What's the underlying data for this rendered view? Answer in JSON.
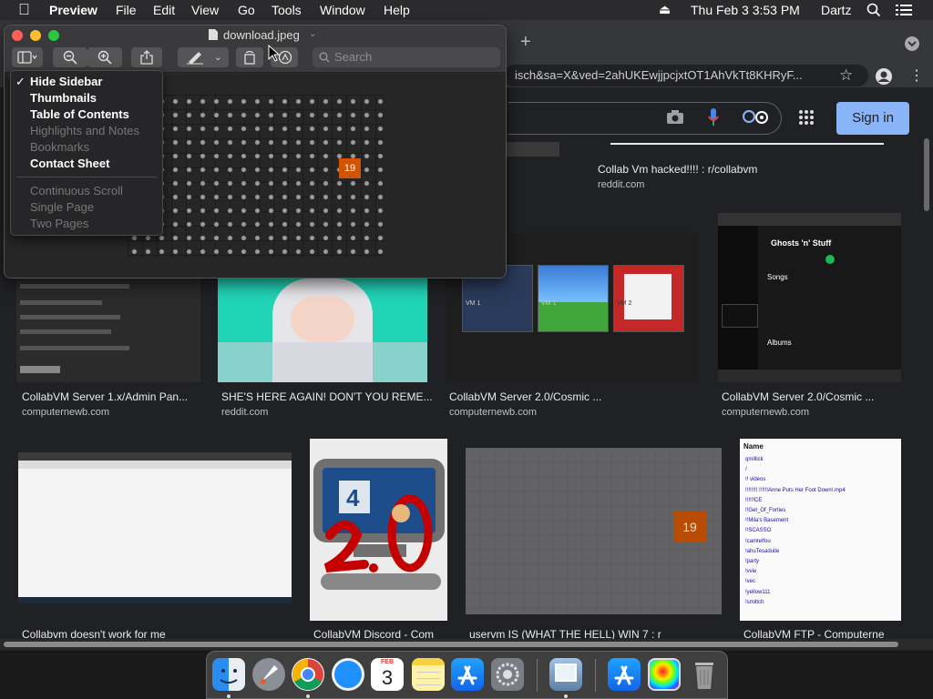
{
  "menubar": {
    "app": "Preview",
    "items": [
      "File",
      "Edit",
      "View",
      "Go",
      "Tools",
      "Window",
      "Help"
    ],
    "clock": "Thu Feb 3  3:53 PM",
    "user": "Dartz"
  },
  "browser": {
    "url": "isch&sa=X&ved=2ahUKEwjjpcjxtOT1AhVkTt8KHRyF...",
    "signin": "Sign in",
    "results": [
      {
        "caption": "Collab Vm hacked!!!! : r/collabvm",
        "source": "reddit.com"
      },
      {
        "caption": "CollabVM Server 1.x/Admin Pan...",
        "source": "computernewb.com"
      },
      {
        "caption": "SHE'S HERE AGAIN! DON'T YOU REME...",
        "source": "reddit.com"
      },
      {
        "caption": "CollabVM Server 2.0/Cosmic ...",
        "source": "computernewb.com"
      },
      {
        "caption": "CollabVM Server 2.0/Cosmic ...",
        "source": "computernewb.com"
      },
      {
        "caption": "Collabvm doesn't work for me",
        "source": ""
      },
      {
        "caption": "CollabVM Discord - Com",
        "source": ""
      },
      {
        "caption": "uservm IS (WHAT THE HELL) WIN 7 : r",
        "source": ""
      },
      {
        "caption": "CollabVM FTP - Computerne",
        "source": ""
      }
    ],
    "ftp_list": [
      "Name",
      "qmillick",
      "/",
      "!! videos",
      "!!!!!!!! !!!!!!Anne Puts Her Foot Down!.mp4",
      "!!!!!!CE",
      "!!Get_Of_Forties",
      "!!Mila's Basement",
      "!!SCASSO",
      "!camtelfou",
      "!ahuTesaduite",
      "!party",
      "!vvie",
      "!vec",
      "!yellow111",
      "!smiltch"
    ],
    "vm_labels": [
      "VM 1",
      "VM 1",
      "VM 2"
    ],
    "spotify_labels": [
      "Ghosts 'n' Stuff",
      "Songs",
      "Albums"
    ],
    "thumb_date": "19",
    "calendar": {
      "month": "FEB",
      "day": "3"
    }
  },
  "preview": {
    "title": "download.jpeg",
    "search_placeholder": "Search",
    "menu": {
      "items": [
        {
          "label": "Hide Sidebar",
          "check": "✓",
          "enabled": true
        },
        {
          "label": "Thumbnails",
          "check": "",
          "enabled": true
        },
        {
          "label": "Table of Contents",
          "check": "",
          "enabled": true
        },
        {
          "label": "Highlights and Notes",
          "check": "",
          "enabled": false
        },
        {
          "label": "Bookmarks",
          "check": "",
          "enabled": false
        },
        {
          "label": "Contact Sheet",
          "check": "",
          "enabled": true
        },
        {
          "label": "Continuous Scroll",
          "check": "",
          "enabled": false
        },
        {
          "label": "Single Page",
          "check": "",
          "enabled": false
        },
        {
          "label": "Two Pages",
          "check": "",
          "enabled": false
        }
      ]
    },
    "image_date": "19"
  },
  "dock": {
    "apps": [
      "Finder",
      "Launchpad",
      "Chrome",
      "Safari",
      "Calendar",
      "Notes",
      "App Store",
      "System Preferences",
      "Preview",
      "Downloads",
      "Preview document",
      "Trash"
    ]
  }
}
